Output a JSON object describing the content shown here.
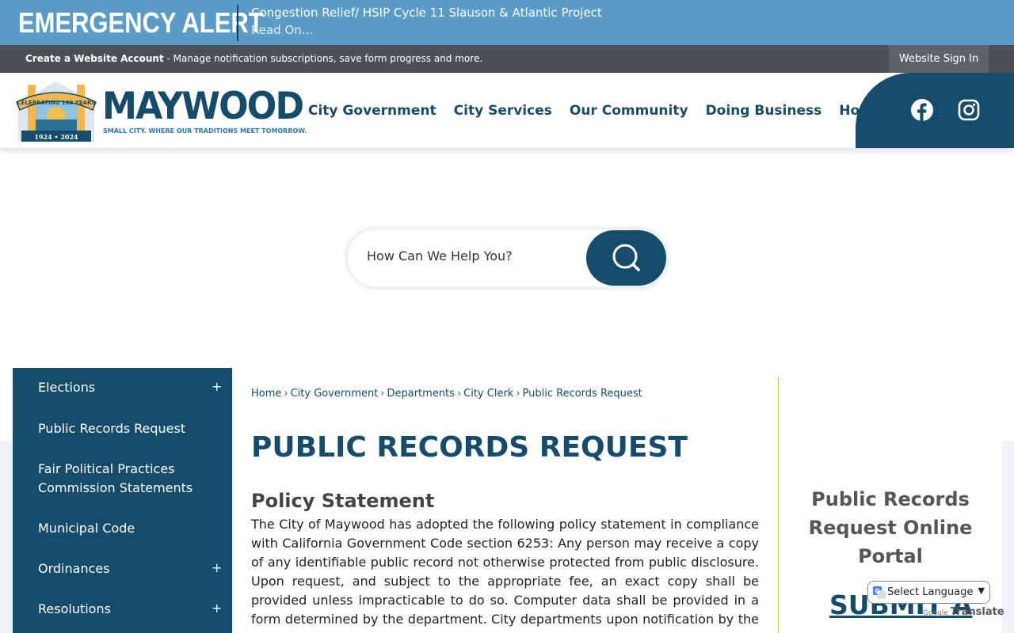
{
  "alert": {
    "title": "EMERGENCY ALERT",
    "headline": "Congestion Relief/ HSIP Cycle 11 Slauson & Atlantic Project",
    "read_on": "Read On..."
  },
  "account_bar": {
    "create_label": "Create a Website Account",
    "description": " - Manage notification subscriptions, save form progress and more.",
    "sign_in": "Website Sign In"
  },
  "header": {
    "logo": {
      "name": "MAYWOOD",
      "tagline": "SMALL CITY. WHERE OUR TRADITIONS MEET TOMORROW.",
      "badge_text": "CELEBRATING 100 YEARS",
      "badge_years": "1924 • 2024"
    },
    "nav": [
      "City Government",
      "City Services",
      "Our Community",
      "Doing Business",
      "How Do I..."
    ],
    "social": [
      "facebook-icon",
      "instagram-icon"
    ]
  },
  "search": {
    "placeholder": "How Can We Help You?"
  },
  "sidebar": {
    "items": [
      {
        "label": "Elections",
        "expand": "+"
      },
      {
        "label": "Public Records Request",
        "expand": ""
      },
      {
        "label": "Fair Political Practices Commission Statements",
        "expand": ""
      },
      {
        "label": "Municipal Code",
        "expand": ""
      },
      {
        "label": "Ordinances",
        "expand": "+"
      },
      {
        "label": "Resolutions",
        "expand": "+"
      }
    ]
  },
  "breadcrumb": [
    "Home",
    "City Government",
    "Departments",
    "City Clerk",
    "Public Records Request"
  ],
  "main": {
    "title": "PUBLIC RECORDS REQUEST",
    "section_title": "Policy Statement",
    "body": "The City of Maywood has adopted the following policy statement in compliance with California Government Code section 6253: Any person may receive a copy of any identifiable public record not otherwise protected from public disclosure. Upon request, and subject to the appropriate fee, an exact copy shall be provided unless impracticable to do so. Computer data shall be provided in a form determined by the department. City departments upon notification by the City Clerk of any request"
  },
  "right_panel": {
    "portal_title": "Public Records Request Online Portal",
    "submit_label": "SUBMIT A"
  },
  "translate": {
    "select_label": "Select Language",
    "powered_by": "Google",
    "translate_label": "Translate"
  },
  "colors": {
    "primary": "#154c6b",
    "alert_bg": "#5b9bc7",
    "account_bg": "#4c5055",
    "accent_line": "#e2b65a"
  }
}
